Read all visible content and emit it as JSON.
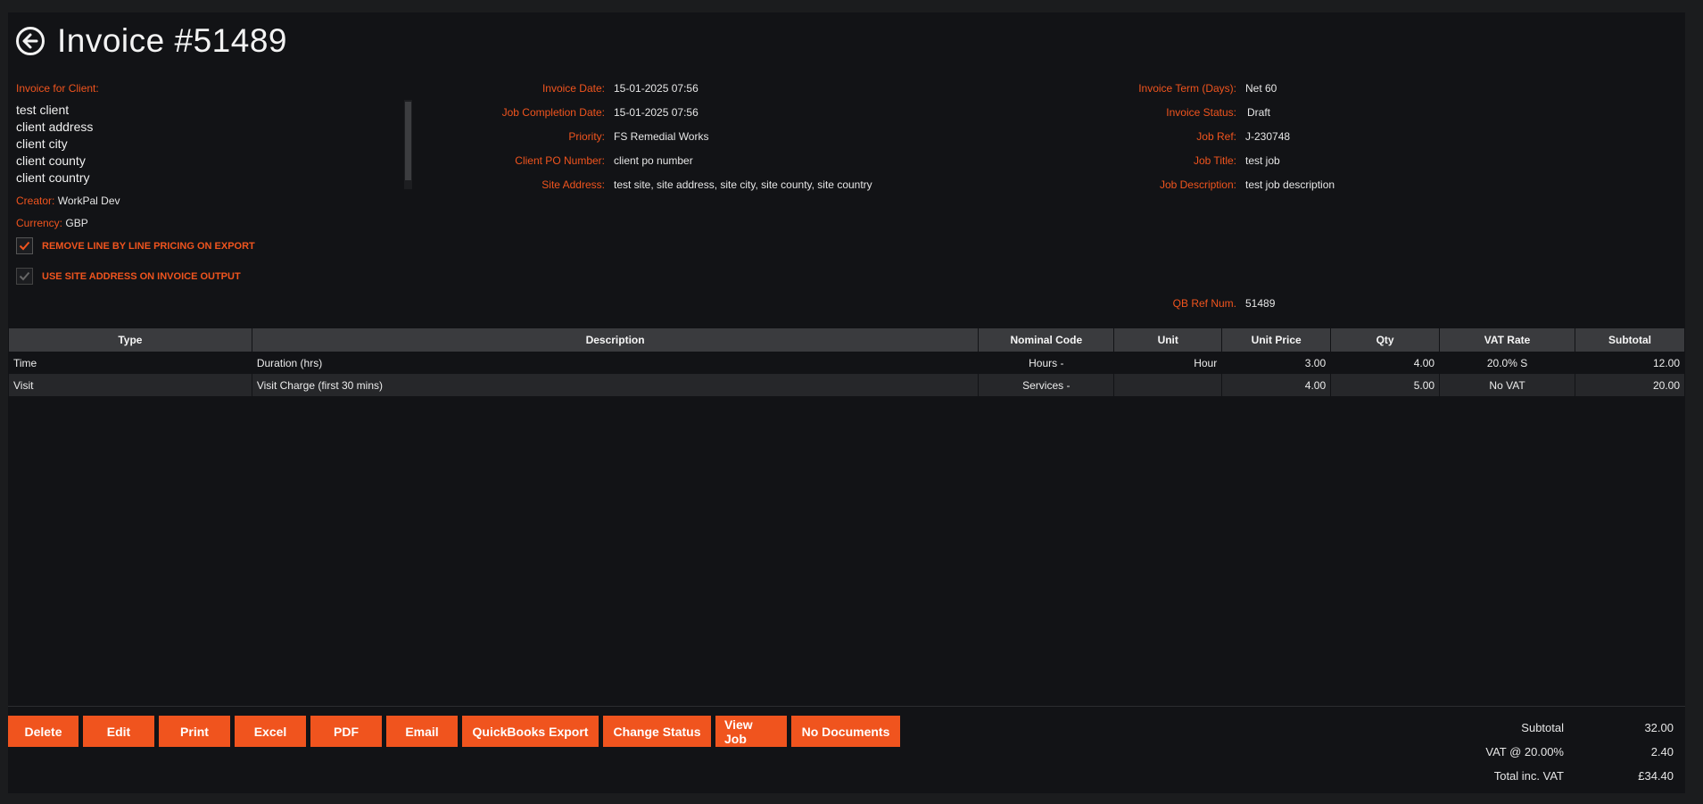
{
  "header": {
    "title": "Invoice #51489"
  },
  "client": {
    "label": "Invoice for Client:",
    "lines": [
      "test client",
      "client address",
      "client city",
      "client county",
      "client country"
    ],
    "creator_label": "Creator:",
    "creator": "WorkPal Dev",
    "currency_label": "Currency:",
    "currency": "GBP"
  },
  "options": {
    "remove_pricing_label": "REMOVE LINE BY LINE PRICING ON EXPORT",
    "remove_pricing_checked": true,
    "use_site_address_label": "USE SITE ADDRESS ON INVOICE OUTPUT",
    "use_site_address_checked": true
  },
  "details_mid": [
    {
      "label": "Invoice Date:",
      "value": "15-01-2025 07:56"
    },
    {
      "label": "Job Completion Date:",
      "value": "15-01-2025 07:56"
    },
    {
      "label": "Priority:",
      "value": "FS Remedial Works"
    },
    {
      "label": "Client PO Number:",
      "value": "client po number"
    },
    {
      "label": "Site Address:",
      "value": "test site, site address, site city, site county, site country"
    }
  ],
  "details_right": [
    {
      "label": "Invoice Term (Days):",
      "value": "Net 60"
    },
    {
      "label": "Invoice Status:",
      "value": "Draft"
    },
    {
      "label": "Job Ref:",
      "value": "J-230748"
    },
    {
      "label": "Job Title:",
      "value": "test job"
    },
    {
      "label": "Job Description:",
      "value": "test job description"
    }
  ],
  "qb_ref": {
    "label": "QB Ref Num.",
    "value": "51489"
  },
  "table": {
    "columns": [
      "Type",
      "Description",
      "Nominal Code",
      "Unit",
      "Unit Price",
      "Qty",
      "VAT Rate",
      "Subtotal"
    ],
    "rows": [
      [
        "Time",
        "Duration (hrs)",
        "Hours -",
        "Hour",
        "3.00",
        "4.00",
        "20.0% S",
        "12.00"
      ],
      [
        "Visit",
        "Visit Charge (first 30 mins)",
        "Services -",
        "",
        "4.00",
        "5.00",
        "No VAT",
        "20.00"
      ]
    ]
  },
  "buttons": {
    "delete": "Delete",
    "edit": "Edit",
    "print": "Print",
    "excel": "Excel",
    "pdf": "PDF",
    "email": "Email",
    "quickbooks_export": "QuickBooks Export",
    "change_status": "Change Status",
    "view_job": "View Job",
    "no_documents": "No Documents"
  },
  "totals": {
    "subtotal_label": "Subtotal",
    "subtotal": "32.00",
    "vat_label": "VAT @ 20.00%",
    "vat": "2.40",
    "total_label": "Total inc. VAT",
    "total": "£34.40"
  },
  "colors": {
    "accent": "#f0541e",
    "background": "#121316",
    "header_row": "#3a3b3e"
  }
}
